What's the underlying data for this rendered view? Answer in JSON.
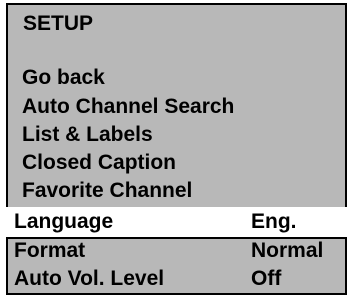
{
  "menu": {
    "title": "SETUP",
    "items": [
      {
        "label": "Go back"
      },
      {
        "label": "Auto Channel Search"
      },
      {
        "label": "List & Labels"
      },
      {
        "label": "Closed Caption"
      },
      {
        "label": "Favorite Channel"
      }
    ],
    "settings": [
      {
        "label": "Language",
        "value": "Eng.",
        "selected": true
      },
      {
        "label": "Format",
        "value": "Normal",
        "selected": false
      },
      {
        "label": "Auto Vol. Level",
        "value": "Off",
        "selected": false
      }
    ]
  },
  "colors": {
    "panel_background": "#b8b8b8",
    "selected_background": "#ffffff",
    "border": "#000000",
    "text": "#000000"
  }
}
